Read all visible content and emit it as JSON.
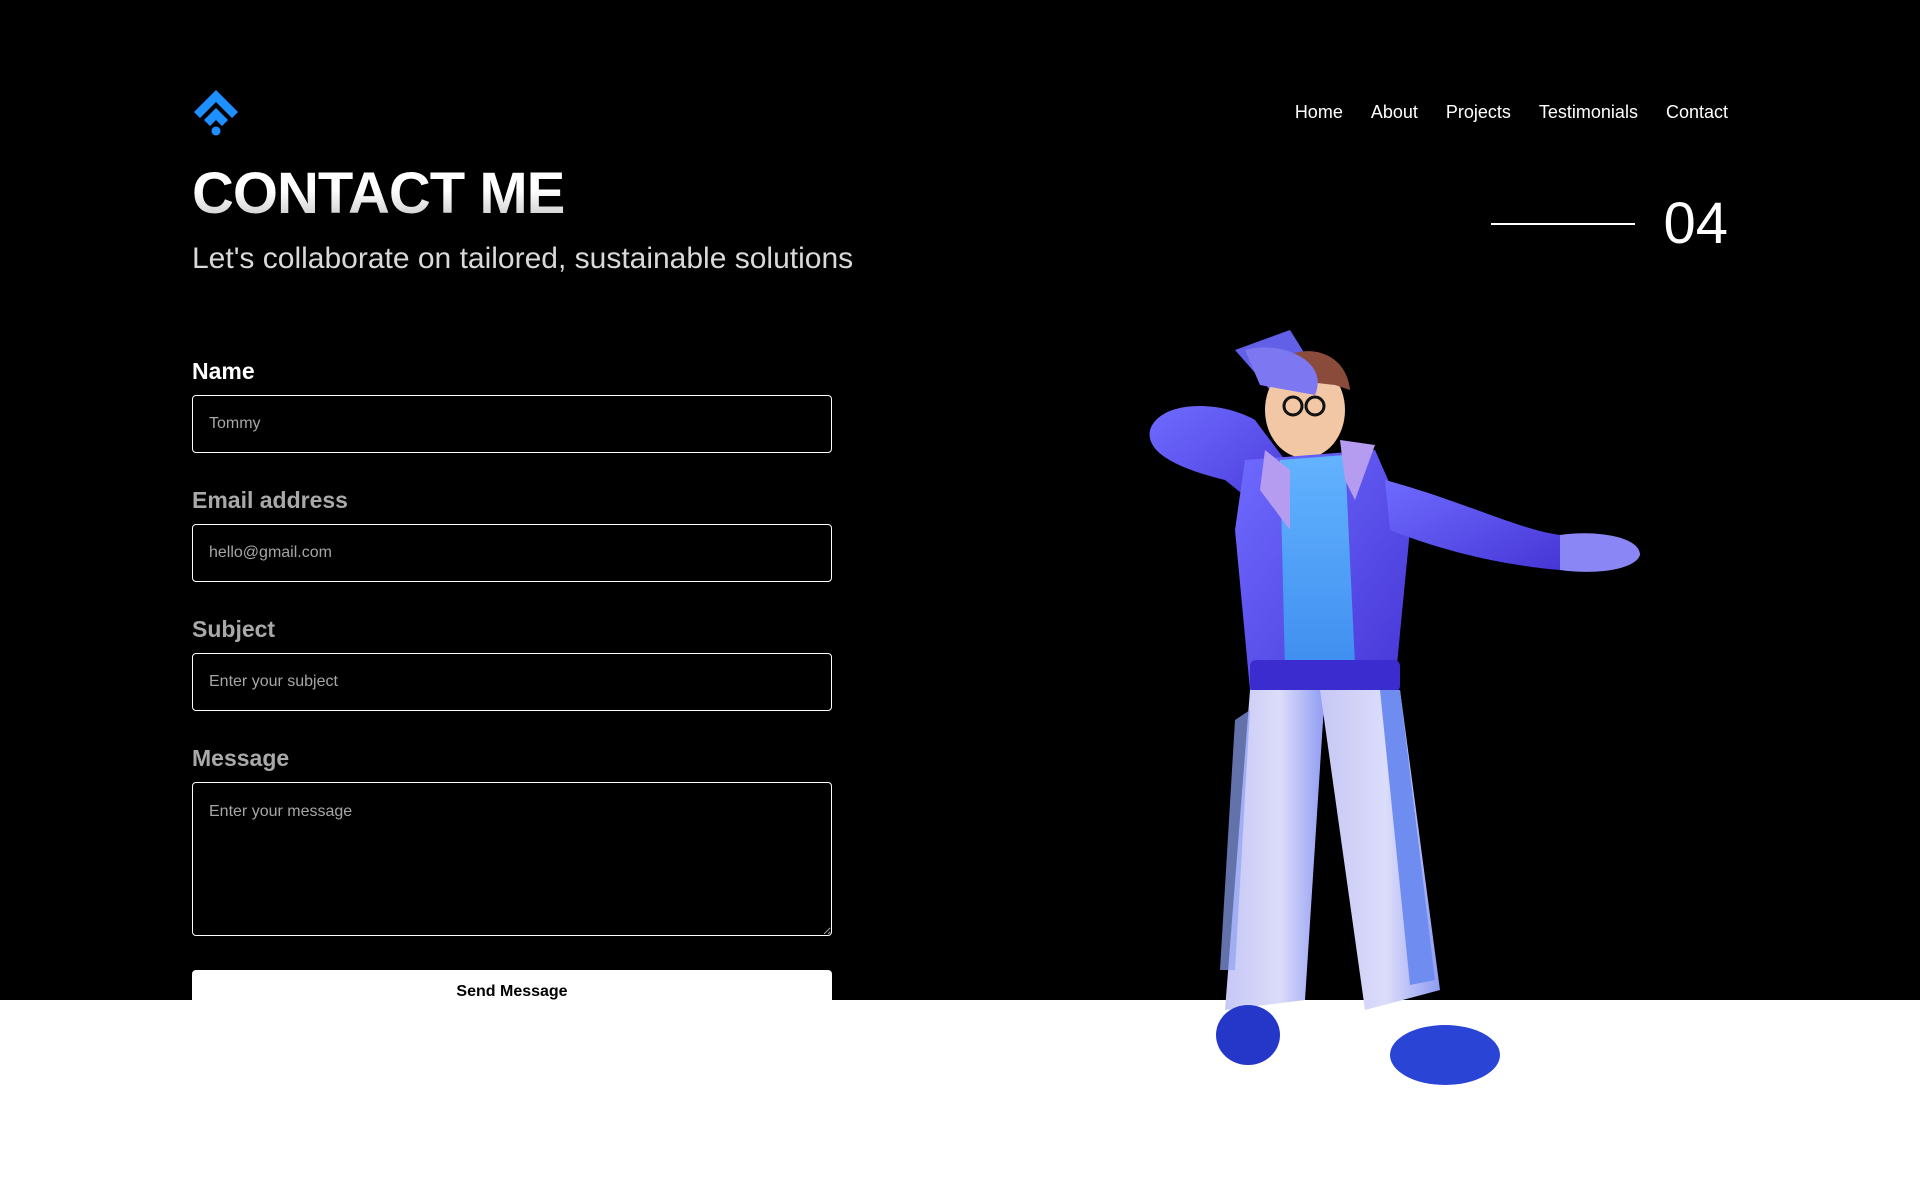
{
  "top_clip_text": "····",
  "nav": {
    "items": [
      {
        "label": "Home"
      },
      {
        "label": "About"
      },
      {
        "label": "Projects"
      },
      {
        "label": "Testimonials"
      },
      {
        "label": "Contact"
      }
    ]
  },
  "header": {
    "title": "CONTACT ME",
    "subtitle": "Let's collaborate on tailored, sustainable solutions",
    "section_number": "04"
  },
  "form": {
    "name": {
      "label": "Name",
      "placeholder": "Tommy"
    },
    "email": {
      "label": "Email address",
      "placeholder": "hello@gmail.com"
    },
    "subject": {
      "label": "Subject",
      "placeholder": "Enter your subject"
    },
    "message": {
      "label": "Message",
      "placeholder": "Enter your message"
    },
    "submit_label": "Send Message"
  },
  "colors": {
    "background": "#000000",
    "accent": "#1e8fff",
    "text": "#ffffff",
    "muted_label": "#a9a9a9",
    "footer": "#ffffff"
  },
  "icons": {
    "logo": "layered-diamond-logo-icon"
  }
}
